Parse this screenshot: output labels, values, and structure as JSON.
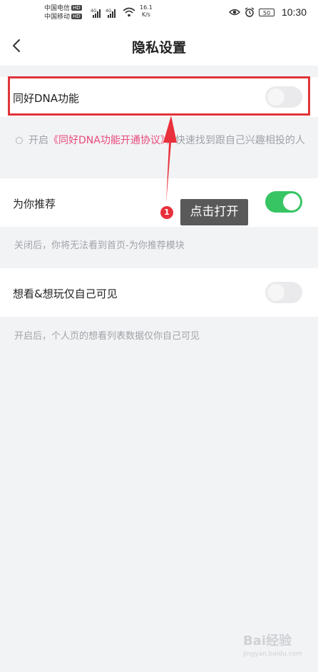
{
  "status_bar": {
    "carrier1": "中国电信",
    "carrier2": "中国移动",
    "hd": "HD",
    "net1": "4G",
    "net2": "4G",
    "speed_value": "16.1",
    "speed_unit": "K/s",
    "battery": "50",
    "time": "10:30"
  },
  "header": {
    "title": "隐私设置"
  },
  "settings": {
    "dna": {
      "label": "同好DNA功能",
      "enabled": false
    },
    "agreement": {
      "prefix": "开启",
      "link": "《同好DNA功能开通协议》",
      "suffix": "，快速找到跟自己兴趣相投的人"
    },
    "recommend": {
      "label": "为你推荐",
      "enabled": true,
      "description": "关闭后，你将无法看到首页-为你推荐模块"
    },
    "want_private": {
      "label": "想看&想玩仅自己可见",
      "enabled": false,
      "description": "开启后，个人页的想看列表数据仅你自己可见"
    }
  },
  "annotation": {
    "step": "1",
    "text": "点击打开",
    "highlight_color": "#e0343a"
  },
  "watermark": {
    "text": "Bai经验",
    "sub": "jingyan.baidu.com"
  },
  "colors": {
    "accent_green": "#37c563",
    "link_pink": "#e8497a"
  }
}
